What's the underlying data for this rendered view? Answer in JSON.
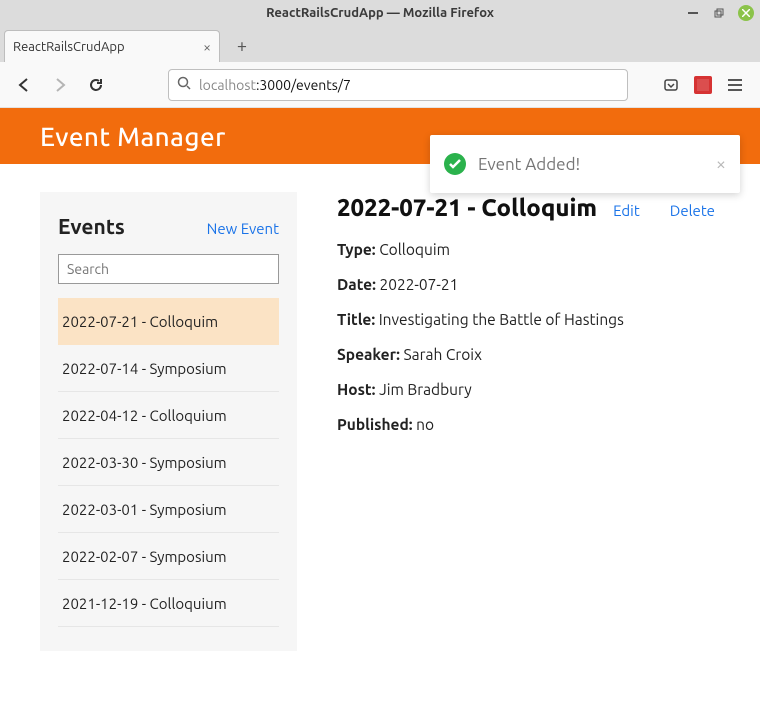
{
  "os": {
    "title": "ReactRailsCrudApp — Mozilla Firefox"
  },
  "browser": {
    "tab_title": "ReactRailsCrudApp",
    "url_host": "localhost",
    "url_path": ":3000/events/7"
  },
  "header": {
    "title": "Event Manager"
  },
  "toast": {
    "message": "Event Added!"
  },
  "sidebar": {
    "heading": "Events",
    "new_label": "New Event",
    "search_placeholder": "Search",
    "items": [
      "2022-07-21 - Colloquim",
      "2022-07-14 - Symposium",
      "2022-04-12 - Colloquium",
      "2022-03-30 - Symposium",
      "2022-03-01 - Symposium",
      "2022-02-07 - Symposium",
      "2021-12-19 - Colloquium"
    ]
  },
  "detail": {
    "heading": "2022-07-21 - Colloquim",
    "edit": "Edit",
    "delete": "Delete",
    "labels": {
      "type": "Type:",
      "date": "Date:",
      "title": "Title:",
      "speaker": "Speaker:",
      "host": "Host:",
      "published": "Published:"
    },
    "values": {
      "type": "Colloquim",
      "date": "2022-07-21",
      "title": "Investigating the Battle of Hastings",
      "speaker": "Sarah Croix",
      "host": "Jim Bradbury",
      "published": "no"
    }
  }
}
